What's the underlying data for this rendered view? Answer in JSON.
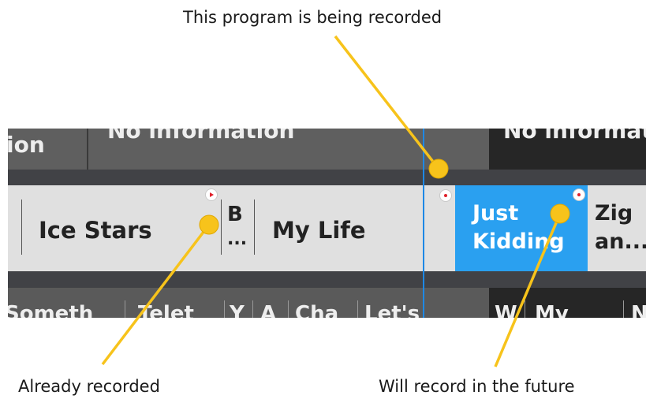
{
  "captions": {
    "top": "This program is being recorded",
    "left": "Already recorded",
    "right": "Will record in the future"
  },
  "guide": {
    "top_row": {
      "cells": [
        "ion",
        "No information",
        "No informat"
      ]
    },
    "mid_row": {
      "programs": [
        "Ice Stars",
        "B",
        "...",
        "My Life",
        "Just",
        "Kidding",
        "Zig",
        "an..."
      ]
    },
    "bottom_row": {
      "cells": [
        "Someth",
        "Telet",
        "Y",
        "A",
        "Cha",
        "Let's",
        "W",
        "My",
        "N"
      ]
    }
  },
  "icons": {
    "recorded": "recorded-play-icon",
    "recording_now": "recording-dot-icon",
    "scheduled": "scheduled-record-icon"
  },
  "colors": {
    "highlight": "#2aa0f0",
    "callout": "#f7c31b",
    "now_line": "#1e88e5",
    "record_red": "#e0202a"
  }
}
